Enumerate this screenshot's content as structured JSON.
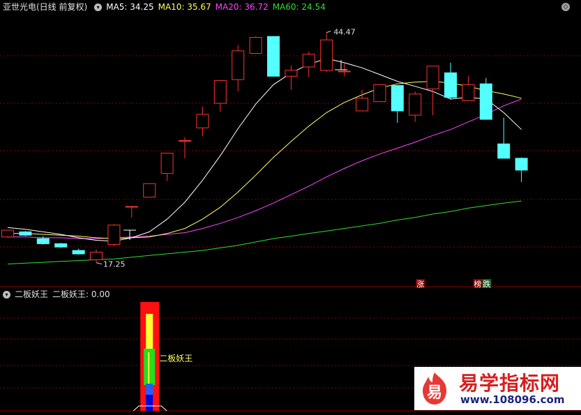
{
  "header": {
    "stock_title": "亚世光电(日线 前复权)",
    "ma5_label": "MA5: 34.25",
    "ma10_label": "MA10: 35.67",
    "ma20_label": "MA20: 36.72",
    "ma60_label": "MA60: 24.54",
    "colors": {
      "ma5": "#ffffff",
      "ma10": "#ffff66",
      "ma20": "#ff44ff",
      "ma60": "#33dd33"
    }
  },
  "sub_header": {
    "indicator_name": "二板妖王",
    "indicator_value_label": "二板妖王: 0.00"
  },
  "annotations": {
    "high_label": "44.47",
    "low_label": "17.25",
    "signal_label": "二板妖王",
    "tag_zhang": "涨",
    "tag_bang": "榜",
    "tag_die": "跌"
  },
  "watermark": {
    "title": "易学指标网",
    "url": "www.108096.com",
    "logo_char": "易"
  },
  "chart_data": {
    "type": "candlestick",
    "price_range": [
      14.5,
      46.5
    ],
    "up_color": "#ff3232",
    "down_color": "#54ffff",
    "candles": [
      {
        "o": 20.3,
        "c": 21.1,
        "h": 21.1,
        "l": 20.2
      },
      {
        "o": 20.9,
        "c": 20.5,
        "h": 21.0,
        "l": 20.4
      },
      {
        "o": 20.1,
        "c": 19.5,
        "h": 20.4,
        "l": 19.4
      },
      {
        "o": 19.5,
        "c": 19.1,
        "h": 19.6,
        "l": 19.0
      },
      {
        "o": 18.7,
        "c": 18.3,
        "h": 18.9,
        "l": 18.2
      },
      {
        "o": 17.6,
        "c": 18.5,
        "h": 18.8,
        "l": 17.25
      },
      {
        "o": 19.4,
        "c": 21.7,
        "h": 21.8,
        "l": 19.2
      },
      {
        "o": 23.9,
        "c": 23.9,
        "h": 23.9,
        "l": 22.6
      },
      {
        "o": 25.0,
        "c": 26.6,
        "h": 26.6,
        "l": 25.0
      },
      {
        "o": 27.8,
        "c": 30.2,
        "h": 30.2,
        "l": 26.9
      },
      {
        "o": 31.7,
        "c": 31.7,
        "h": 32.1,
        "l": 29.6
      },
      {
        "o": 33.2,
        "c": 34.8,
        "h": 35.7,
        "l": 32.2
      },
      {
        "o": 36.1,
        "c": 38.8,
        "h": 38.8,
        "l": 35.1
      },
      {
        "o": 38.9,
        "c": 42.3,
        "h": 43.0,
        "l": 37.5
      },
      {
        "o": 42.0,
        "c": 43.9,
        "h": 44.0,
        "l": 42.0
      },
      {
        "o": 44.0,
        "c": 39.3,
        "h": 44.0,
        "l": 39.3
      },
      {
        "o": 39.3,
        "c": 40.0,
        "h": 40.6,
        "l": 37.7
      },
      {
        "o": 40.4,
        "c": 41.9,
        "h": 42.2,
        "l": 39.2
      },
      {
        "o": 40.0,
        "c": 43.6,
        "h": 44.47,
        "l": 39.8
      },
      {
        "o": 39.9,
        "c": 39.9,
        "h": 40.9,
        "l": 39.3
      },
      {
        "o": 35.2,
        "c": 36.7,
        "h": 37.7,
        "l": 35.2
      },
      {
        "o": 36.3,
        "c": 38.3,
        "h": 38.3,
        "l": 36.3
      },
      {
        "o": 38.2,
        "c": 35.2,
        "h": 38.2,
        "l": 33.8
      },
      {
        "o": 34.7,
        "c": 37.2,
        "h": 37.5,
        "l": 33.9
      },
      {
        "o": 37.8,
        "c": 40.5,
        "h": 40.5,
        "l": 34.7
      },
      {
        "o": 39.7,
        "c": 36.8,
        "h": 40.9,
        "l": 36.5
      },
      {
        "o": 36.4,
        "c": 38.3,
        "h": 39.3,
        "l": 36.4
      },
      {
        "o": 38.4,
        "c": 34.2,
        "h": 39.1,
        "l": 34.2
      },
      {
        "o": 31.3,
        "c": 29.6,
        "h": 34.4,
        "l": 29.6
      },
      {
        "o": 29.6,
        "c": 28.2,
        "h": 29.7,
        "l": 26.8
      }
    ],
    "ma5": [
      21.4,
      21.2,
      20.9,
      20.6,
      20.2,
      19.9,
      19.8,
      20.2,
      20.9,
      22.4,
      24.4,
      27.0,
      29.9,
      33.1,
      36.0,
      38.3,
      39.7,
      40.7,
      41.4,
      40.9,
      40.3,
      39.5,
      38.7,
      38.1,
      37.5,
      36.6,
      36.8,
      36.6,
      35.0,
      33.0
    ],
    "ma10": [
      20.7,
      20.7,
      20.6,
      20.5,
      20.4,
      20.2,
      20.1,
      20.2,
      20.3,
      20.7,
      21.3,
      22.4,
      23.8,
      25.6,
      27.6,
      29.7,
      31.6,
      33.4,
      35.0,
      36.2,
      37.1,
      37.9,
      38.4,
      38.6,
      38.7,
      38.5,
      38.1,
      37.6,
      37.2,
      36.7
    ],
    "ma20": [
      20.3,
      20.3,
      20.2,
      20.2,
      20.1,
      20.1,
      20.2,
      20.3,
      20.4,
      20.6,
      20.8,
      21.3,
      21.9,
      22.6,
      23.4,
      24.3,
      25.3,
      26.3,
      27.4,
      28.4,
      29.3,
      30.1,
      30.8,
      31.5,
      32.3,
      33.0,
      33.9,
      34.8,
      35.8,
      36.6
    ],
    "ma60": [
      17.1,
      17.2,
      17.3,
      17.4,
      17.5,
      17.6,
      17.7,
      17.9,
      18.1,
      18.3,
      18.5,
      18.7,
      19.0,
      19.3,
      19.7,
      20.1,
      20.4,
      20.7,
      21.0,
      21.3,
      21.6,
      21.9,
      22.3,
      22.6,
      23.0,
      23.3,
      23.7,
      24.0,
      24.3,
      24.54
    ],
    "sub_indicator": {
      "name": "二板妖王",
      "value": 0.0,
      "signal_index": 8
    }
  }
}
